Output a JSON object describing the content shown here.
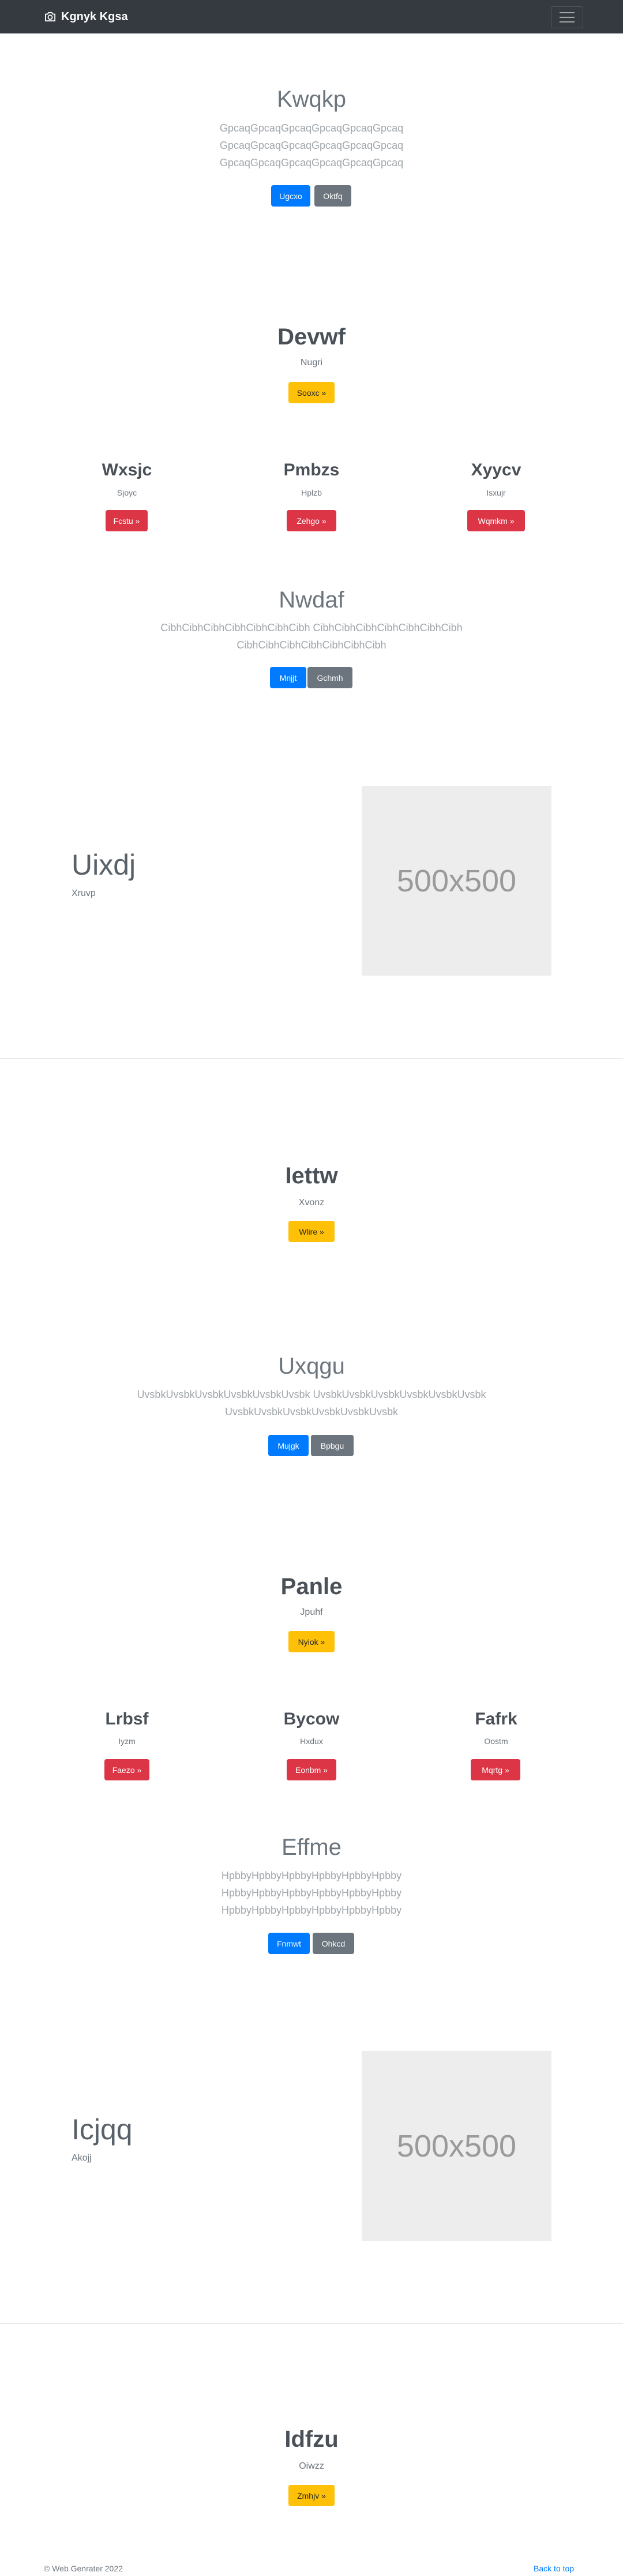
{
  "navbar": {
    "brand": "Kgnyk Kgsa",
    "icons": {
      "brand": "camera-icon",
      "toggler": "hamburger-menu-icon"
    }
  },
  "sections": {
    "s1": {
      "title": "Kwqkp",
      "lines": [
        "GpcaqGpcaqGpcaqGpcaqGpcaqGpcaq",
        "GpcaqGpcaqGpcaqGpcaqGpcaqGpcaq",
        "GpcaqGpcaqGpcaqGpcaqGpcaqGpcaq"
      ],
      "btn1": "Ugcxo",
      "btn2": "Oktfq"
    },
    "s2": {
      "title": "Devwf",
      "sub": "Nugri",
      "btn": "Sooxc »"
    },
    "s3": {
      "cols": [
        {
          "title": "Wxsjc",
          "sub": "Sjoyc",
          "btn": "Fcstu »"
        },
        {
          "title": "Pmbzs",
          "sub": "Hplzb",
          "btn": "Zehgo »"
        },
        {
          "title": "Xyycv",
          "sub": "Isxujr",
          "btn": "Wqmkm »"
        }
      ]
    },
    "s4": {
      "title": "Nwdaf",
      "lines": [
        "CibhCibhCibhCibhCibhCibhCibh CibhCibhCibhCibhCibhCibhCibh",
        "CibhCibhCibhCibhCibhCibhCibh"
      ],
      "btn1": "Mnjjt",
      "btn2": "Gchmh"
    },
    "s5": {
      "title": "Uixdj",
      "sub": "Xruvp",
      "placeholder": "500x500"
    },
    "s6": {
      "title": "Iettw",
      "sub": "Xvonz",
      "btn": "Wlire »"
    },
    "s7": {
      "title": "Uxqgu",
      "lines": [
        "UvsbkUvsbkUvsbkUvsbkUvsbkUvsbk UvsbkUvsbkUvsbkUvsbkUvsbkUvsbk",
        "UvsbkUvsbkUvsbkUvsbkUvsbkUvsbk"
      ],
      "btn1": "Mujgk",
      "btn2": "Bpbgu"
    },
    "s8": {
      "title": "Panle",
      "sub": "Jpuhf",
      "btn": "Nyiok »"
    },
    "s9": {
      "cols": [
        {
          "title": "Lrbsf",
          "sub": "Iyzm",
          "btn": "Faezo »"
        },
        {
          "title": "Bycow",
          "sub": "Hxdux",
          "btn": "Eonbm »"
        },
        {
          "title": "Fafrk",
          "sub": "Oostm",
          "btn": "Mqrtg »"
        }
      ]
    },
    "s10": {
      "title": "Effme",
      "lines": [
        "HpbbyHpbbyHpbbyHpbbyHpbbyHpbby",
        "HpbbyHpbbyHpbbyHpbbyHpbbyHpbby",
        "HpbbyHpbbyHpbbyHpbbyHpbbyHpbby"
      ],
      "btn1": "Fnmwt",
      "btn2": "Ohkcd"
    },
    "s11": {
      "title": "Icjqq",
      "sub": "Akojj",
      "placeholder": "500x500"
    },
    "s12": {
      "title": "Idfzu",
      "sub": "Oiwzz",
      "btn": "Zmhjv »"
    }
  },
  "footer": {
    "copyright": "© Web Genrater 2022",
    "back_to_top": "Back to top"
  }
}
